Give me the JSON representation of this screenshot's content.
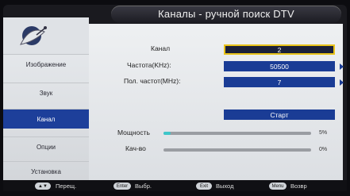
{
  "header": {
    "title": "Каналы - ручной поиск DTV"
  },
  "sidebar": {
    "items": [
      {
        "label": "Изображение",
        "active": false
      },
      {
        "label": "Звук",
        "active": false
      },
      {
        "label": "Канал",
        "active": true
      },
      {
        "label": "Опции",
        "active": false
      },
      {
        "label": "Установка",
        "active": false
      }
    ],
    "logo_icon": "satellite-dish-icon"
  },
  "fields": {
    "channel": {
      "label": "Канал",
      "value": "2"
    },
    "frequency": {
      "label": "Частота(KHz):",
      "value": "50500"
    },
    "bandwidth": {
      "label": "Пол. частот(MHz):",
      "value": "7"
    }
  },
  "start_button": {
    "label": "Старт"
  },
  "meters": {
    "strength": {
      "label": "Мощность",
      "percent_text": "5%",
      "percent": 5
    },
    "quality": {
      "label": "Кач-во",
      "percent_text": "0%",
      "percent": 0
    }
  },
  "hints": [
    {
      "key": "▲▼",
      "text": "Перещ."
    },
    {
      "key": "Enter",
      "text": "Выбр."
    },
    {
      "key": "Exit",
      "text": "Выход"
    },
    {
      "key": "Menu",
      "text": "Возвр"
    }
  ],
  "colors": {
    "accent": "#1a3c95",
    "selected_border": "#e8c21a",
    "meter_fill": "#3ec6c9"
  }
}
